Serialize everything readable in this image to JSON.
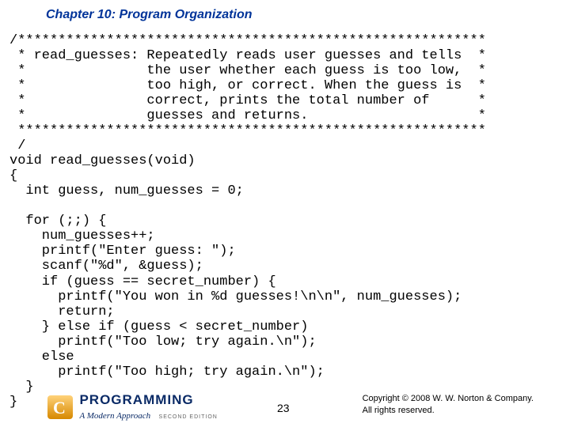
{
  "chapter_title": "Chapter 10: Program Organization",
  "code": "/**********************************************************\n * read_guesses: Repeatedly reads user guesses and tells  *\n *               the user whether each guess is too low,  *\n *               too high, or correct. When the guess is  *\n *               correct, prints the total number of      *\n *               guesses and returns.                     *\n **********************************************************\n /\nvoid read_guesses(void)\n{\n  int guess, num_guesses = 0;\n\n  for (;;) {\n    num_guesses++;\n    printf(\"Enter guess: \");\n    scanf(\"%d\", &guess);\n    if (guess == secret_number) {\n      printf(\"You won in %d guesses!\\n\\n\", num_guesses);\n      return;\n    } else if (guess < secret_number)\n      printf(\"Too low; try again.\\n\");\n    else\n      printf(\"Too high; try again.\\n\");\n  }\n}",
  "logo": {
    "main": "PROGRAMMING",
    "sub": "A Modern Approach",
    "edition": "SECOND EDITION"
  },
  "page_number": "23",
  "copyright_line1": "Copyright © 2008 W. W. Norton & Company.",
  "copyright_line2": "All rights reserved."
}
